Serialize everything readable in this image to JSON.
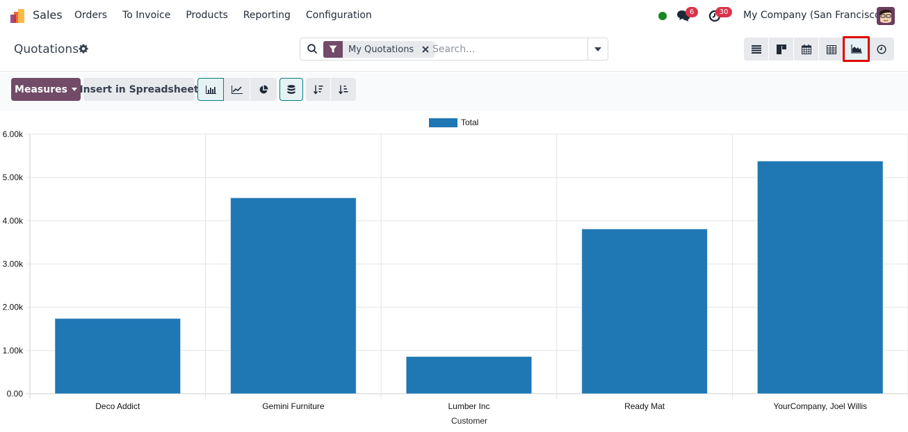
{
  "navbar": {
    "app_name": "Sales",
    "menu": [
      {
        "label": "Orders"
      },
      {
        "label": "To Invoice"
      },
      {
        "label": "Products"
      },
      {
        "label": "Reporting"
      },
      {
        "label": "Configuration"
      }
    ],
    "presence_status": "online",
    "messages_count": "6",
    "activities_count": "30",
    "company": "My Company (San Francisco)",
    "colors": {
      "presence": "#13891f",
      "badge": "#d9344c"
    }
  },
  "control_panel": {
    "title": "Quotations",
    "search": {
      "facet_icon": "filter-icon",
      "facet_label": "My Quotations",
      "placeholder": "Search...",
      "value": ""
    },
    "views": [
      {
        "name": "list",
        "icon": "list-icon",
        "active": false
      },
      {
        "name": "kanban",
        "icon": "kanban-icon",
        "active": false
      },
      {
        "name": "calendar",
        "icon": "calendar-icon",
        "active": false
      },
      {
        "name": "pivot",
        "icon": "pivot-table-icon",
        "active": false
      },
      {
        "name": "graph",
        "icon": "area-chart-icon",
        "active": true
      },
      {
        "name": "activity",
        "icon": "clock-icon",
        "active": false
      }
    ]
  },
  "graph_toolbar": {
    "measures_label": "Measures",
    "insert_label": "Insert in Spreadsheet",
    "chart_types": [
      {
        "name": "bar",
        "icon": "bar-chart-icon",
        "active": true
      },
      {
        "name": "line",
        "icon": "line-chart-icon",
        "active": false
      },
      {
        "name": "pie",
        "icon": "pie-chart-icon",
        "active": false
      }
    ],
    "stacked": {
      "icon": "database-stack-icon",
      "active": true
    },
    "sort": [
      {
        "name": "descending",
        "icon": "sort-descending-icon"
      },
      {
        "name": "ascending",
        "icon": "sort-ascending-icon"
      }
    ],
    "colors": {
      "primary": "#714b67",
      "active_border": "#017e84"
    }
  },
  "chart_data": {
    "type": "bar",
    "title": "",
    "categories": [
      "Deco Addict",
      "Gemini Furniture",
      "Lumber Inc",
      "Ready Mat",
      "YourCompany, Joel Willis"
    ],
    "series": [
      {
        "name": "Total",
        "color": "#1f77b4",
        "values": [
          1740,
          4530,
          860,
          3810,
          5380
        ]
      }
    ],
    "xlabel": "Customer",
    "ylabel": "",
    "ylim": [
      0,
      6000
    ],
    "yticks": [
      0,
      1000,
      2000,
      3000,
      4000,
      5000,
      6000
    ],
    "ytick_labels": [
      "0.00",
      "1.00k",
      "2.00k",
      "3.00k",
      "4.00k",
      "5.00k",
      "6.00k"
    ],
    "grid": true,
    "legend": "top-center"
  }
}
